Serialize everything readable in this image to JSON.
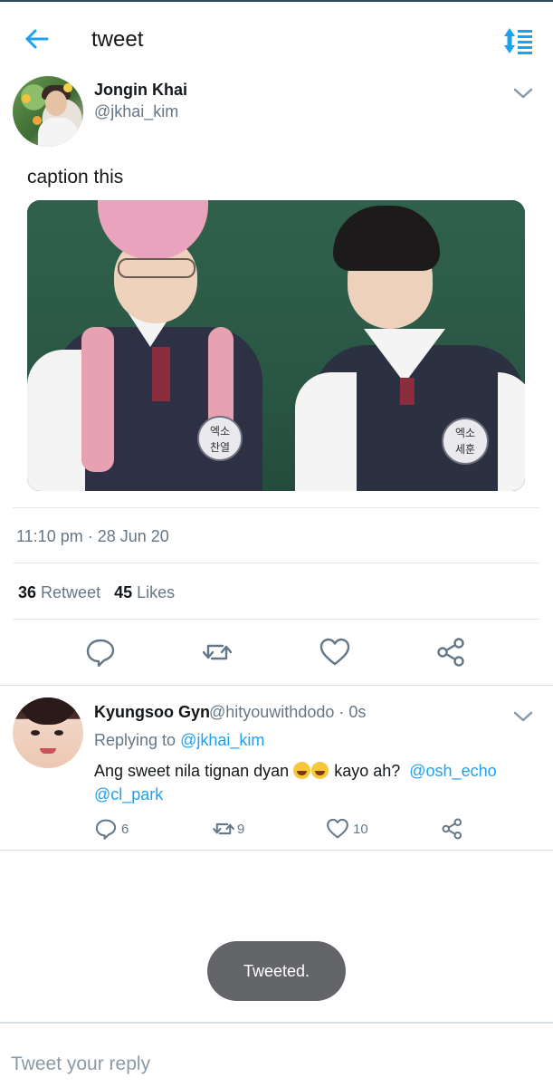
{
  "appbar": {
    "title": "tweet"
  },
  "tweet": {
    "author_name": "Jongin Khai",
    "author_handle": "@jkhai_kim",
    "text": "caption this",
    "media_badges": [
      "엑소\n찬열",
      "엑소\n세훈"
    ],
    "timestamp": "11:10 pm · 28 Jun 20",
    "retweets_count": "36",
    "retweets_label": "Retweet",
    "likes_count": "45",
    "likes_label": "Likes"
  },
  "reply": {
    "author_name": "Kyungsoo Gyn",
    "meta": "@hityouwithdodo · 0s",
    "replying_prefix": "Replying to",
    "replying_to": "@jkhai_kim",
    "text_start": "Ang sweet nila tignan dyan",
    "text_mid": "kayo ah?",
    "mention_1": "@osh_echo",
    "mention_2": "@cl_park",
    "reply_count": "6",
    "retweet_count": "9",
    "like_count": "10"
  },
  "toast": {
    "text": "Tweeted."
  },
  "composer": {
    "placeholder": "Tweet your reply"
  },
  "colors": {
    "accent": "#1da1f2",
    "text_secondary": "#657786",
    "toast_bg": "#636569"
  },
  "icons": [
    "back-arrow-icon",
    "sort-icon",
    "chevron-down-icon",
    "reply-icon",
    "retweet-icon",
    "like-icon",
    "share-icon"
  ]
}
